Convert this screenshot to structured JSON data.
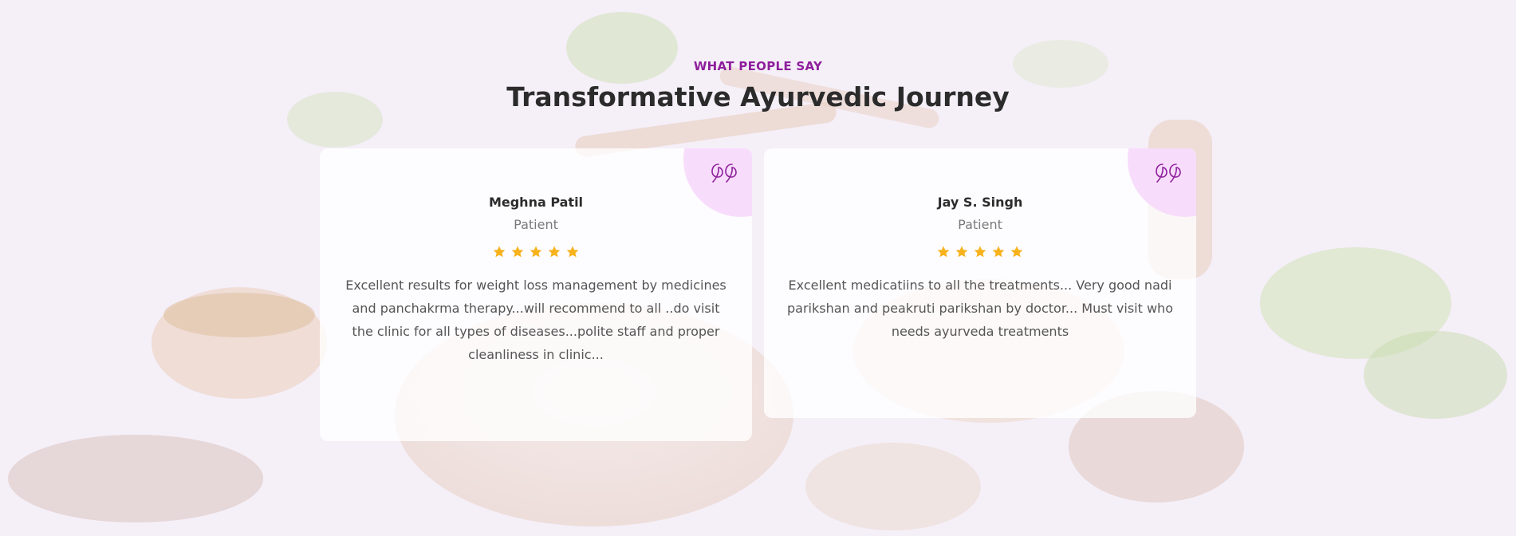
{
  "section": {
    "eyebrow": "WHAT PEOPLE SAY",
    "title": "Transformative Ayurvedic Journey"
  },
  "colors": {
    "accent": "#8e1f9c",
    "star": "#f7b21c",
    "quote_bg": "#f7ddfb",
    "background": "#f5eff8"
  },
  "testimonials": [
    {
      "name": "Meghna Patil",
      "role": "Patient",
      "rating": 5,
      "text": "Excellent results for weight loss management by medicines and panchakrma therapy...will recommend to all ..do visit the clinic for all types of diseases...polite staff and proper cleanliness in clinic...",
      "icon": "quote-icon"
    },
    {
      "name": "Jay S. Singh",
      "role": "Patient",
      "rating": 5,
      "text": "Excellent medicatiins to all the treatments... Very good nadi parikshan and peakruti parikshan by doctor... Must visit who needs ayurveda treatments",
      "icon": "quote-icon"
    }
  ]
}
